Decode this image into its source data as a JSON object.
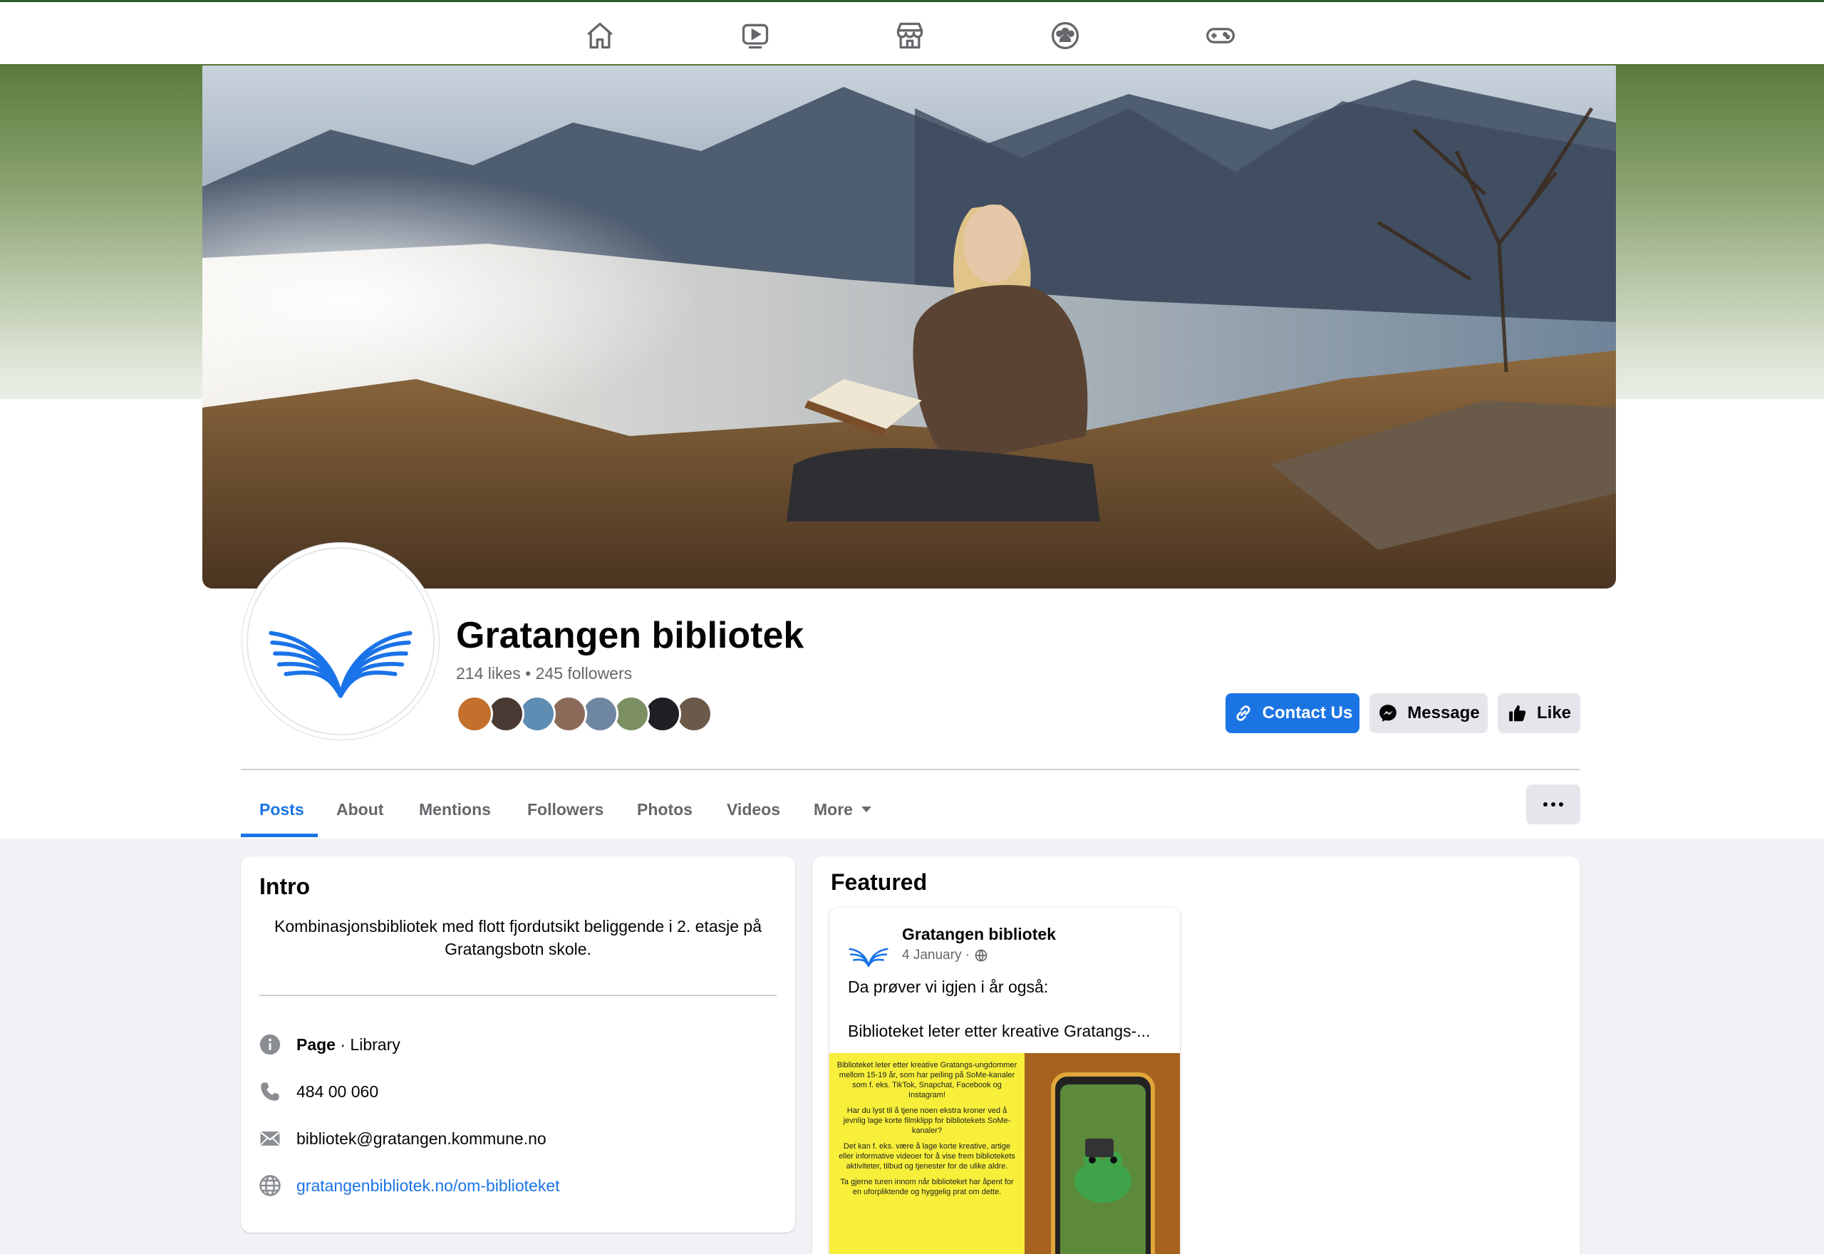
{
  "nav": {
    "icons": [
      "home-icon",
      "video-icon",
      "marketplace-icon",
      "groups-icon",
      "gaming-icon"
    ]
  },
  "profile": {
    "name": "Gratangen bibliotek",
    "stats": "214 likes • 245 followers",
    "follower_avatar_count": 8
  },
  "actions": {
    "contact": "Contact Us",
    "message": "Message",
    "like": "Like"
  },
  "tabs": [
    {
      "label": "Posts",
      "active": true
    },
    {
      "label": "About"
    },
    {
      "label": "Mentions"
    },
    {
      "label": "Followers"
    },
    {
      "label": "Photos"
    },
    {
      "label": "Videos"
    },
    {
      "label": "More"
    }
  ],
  "intro": {
    "title": "Intro",
    "bio": "Kombinasjonsbibliotek med flott fjordutsikt beliggende i 2. etasje på Gratangsbotn skole.",
    "page_label": "Page",
    "category": " · Library",
    "phone": "484 00 060",
    "email": "bibliotek@gratangen.kommune.no",
    "website": "gratangenbibliotek.no/om-biblioteket"
  },
  "featured": {
    "title": "Featured",
    "post": {
      "author": "Gratangen bibliotek",
      "date": "4 January ·",
      "text1": "Da prøver vi igjen i år også:",
      "text2": "Biblioteket leter etter kreative Gratangs-...",
      "image_lines": [
        "Biblioteket leter etter kreative Gratangs-ungdommer mellom 15-19 år, som har peiling på SoMe-kanaler som f. eks. TikTok, Snapchat, Facebook og Instagram!",
        "Har du lyst til å tjene noen ekstra kroner ved å jevnlig lage korte filmklipp for bibliotekets SoMe-kanaler?",
        "Det kan f. eks. være å lage korte kreative, artige eller informative videoer for å vise frem bibliotekets aktiviteter, tilbud og tjenester for de ulike aldre.",
        "Ta gjerne turen innom når biblioteket har åpent for en uforpliktende og hyggelig prat om dette."
      ]
    }
  },
  "colors": {
    "accent": "#1b74e4",
    "muted_text": "#65676b",
    "button_gray": "#e4e6eb",
    "page_bg": "#f0f2f5",
    "logo_blue": "#1a73e8"
  }
}
